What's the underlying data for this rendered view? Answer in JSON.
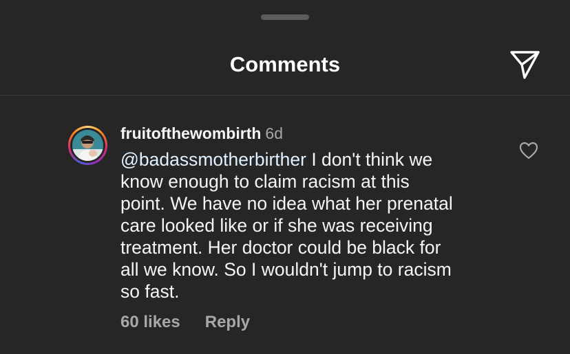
{
  "header": {
    "title": "Comments"
  },
  "comment": {
    "username": "fruitofthewombirth",
    "time": "6d",
    "mention": "@badassmotherbirther",
    "text": " I don't think we\nknow enough to claim racism at this\npoint. We have no idea what her prenatal\ncare looked like or if she was receiving\ntreatment. Her doctor could be black for\nall we know. So I wouldn't jump to racism\nso fast.",
    "likes": "60 likes",
    "reply_label": "Reply"
  },
  "icons": {
    "share": "paper-plane-icon",
    "like": "heart-icon"
  },
  "colors": {
    "background": "#262626",
    "mention": "#e0f1ff",
    "secondary_text": "#a8a8a8"
  }
}
